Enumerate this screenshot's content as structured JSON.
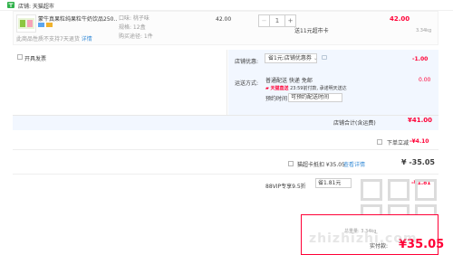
{
  "store": {
    "label": "店铺: 天猫超市"
  },
  "item": {
    "title": "蒙牛真果粒纯果粒牛奶饮品250…",
    "sku_flavor": "口味: 桃子味",
    "sku_spec": "规格: 12盒",
    "sku_purchase": "购买途径: 1件",
    "no_return_notice": "此商品性质不支持7天退货",
    "detail_link": "详情",
    "unit_price": "42.00",
    "quantity": "1",
    "minus": "−",
    "plus": "+",
    "send_note": "送11元超市卡",
    "line_total": "42.00",
    "weight": "3.34kg"
  },
  "invoice": {
    "label": "开具发票"
  },
  "coupon": {
    "label": "店铺优惠:",
    "selected": "省1元:店铺优惠券",
    "amount": "-1.00"
  },
  "shipping": {
    "label": "运送方式:",
    "method": "普通配送 快递 免邮",
    "tmall_badge": "天猫直送",
    "tmall_text": "23:59前付款, 承诺明天送达",
    "fee": "0.00",
    "appt_label": "预约时间",
    "appt_selected": "可预约配送时间"
  },
  "store_total": {
    "label": "店铺合计(含运费)",
    "value": "¥41.00"
  },
  "instant": {
    "label": "下单立减",
    "value": "-¥4.10"
  },
  "card": {
    "label": "猫超卡抵扣 ¥35.05",
    "detail": "查看详情",
    "value": "¥ -35.05"
  },
  "vip": {
    "label": "88VIP专享9.5折",
    "selected": "省1.81元",
    "value": "-¥1.81"
  },
  "summary": {
    "weight": "总重量: 3.34kg",
    "pay_label": "实付款:",
    "pay_value": "¥35.05"
  },
  "watermark": "zhizhizhi.com"
}
